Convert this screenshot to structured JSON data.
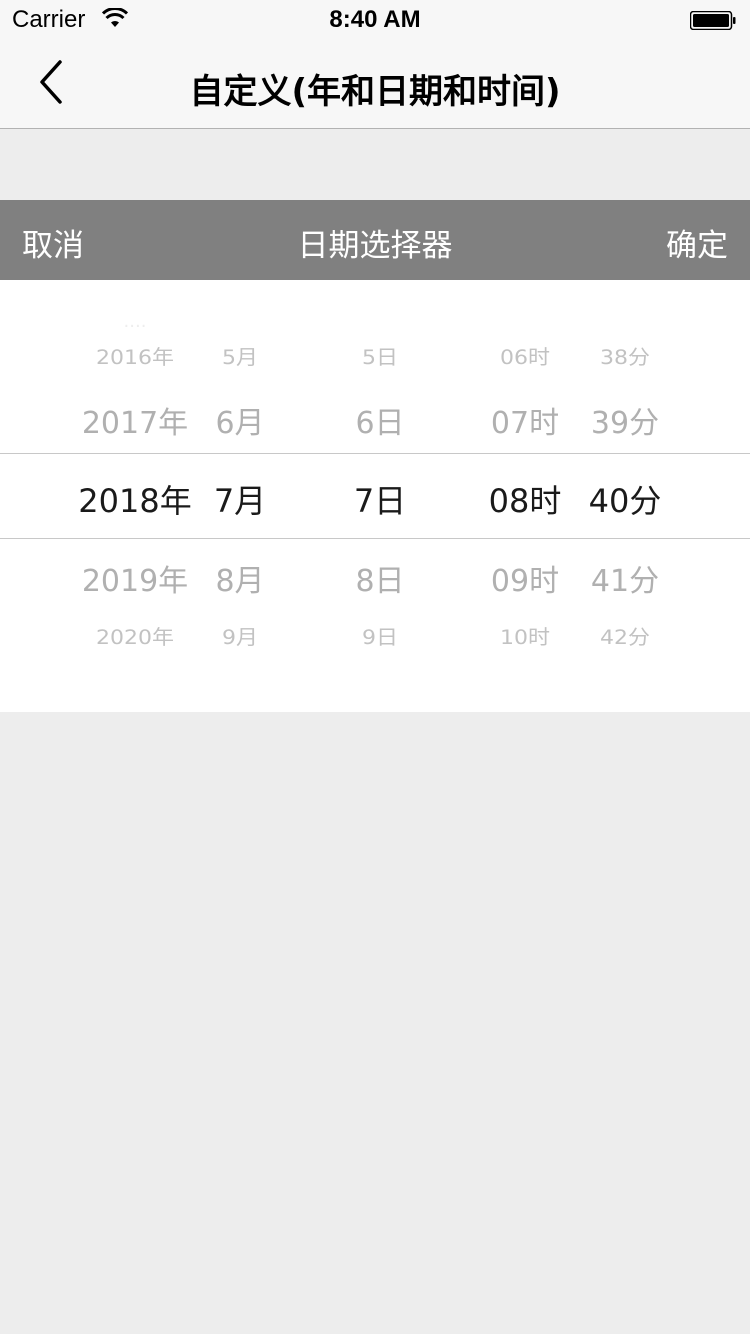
{
  "status_bar": {
    "carrier": "Carrier",
    "time": "8:40 AM"
  },
  "nav": {
    "title": "自定义(年和日期和时间)"
  },
  "picker_toolbar": {
    "cancel_label": "取消",
    "title": "日期选择器",
    "confirm_label": "确定",
    "background": "#808080"
  },
  "picker": {
    "year": {
      "above": [
        "2016年",
        "2017年"
      ],
      "selected": "2018年",
      "below": [
        "2019年",
        "2020年"
      ]
    },
    "month": {
      "above": [
        "5月",
        "6月"
      ],
      "selected": "7月",
      "below": [
        "8月",
        "9月"
      ]
    },
    "day": {
      "above": [
        "5日",
        "6日"
      ],
      "selected": "7日",
      "below": [
        "8日",
        "9日"
      ]
    },
    "hour": {
      "above": [
        "06时",
        "07时"
      ],
      "selected": "08时",
      "below": [
        "09时",
        "10时"
      ]
    },
    "minute": {
      "above": [
        "38分",
        "39分"
      ],
      "selected": "40分",
      "below": [
        "41分",
        "42分"
      ]
    }
  }
}
